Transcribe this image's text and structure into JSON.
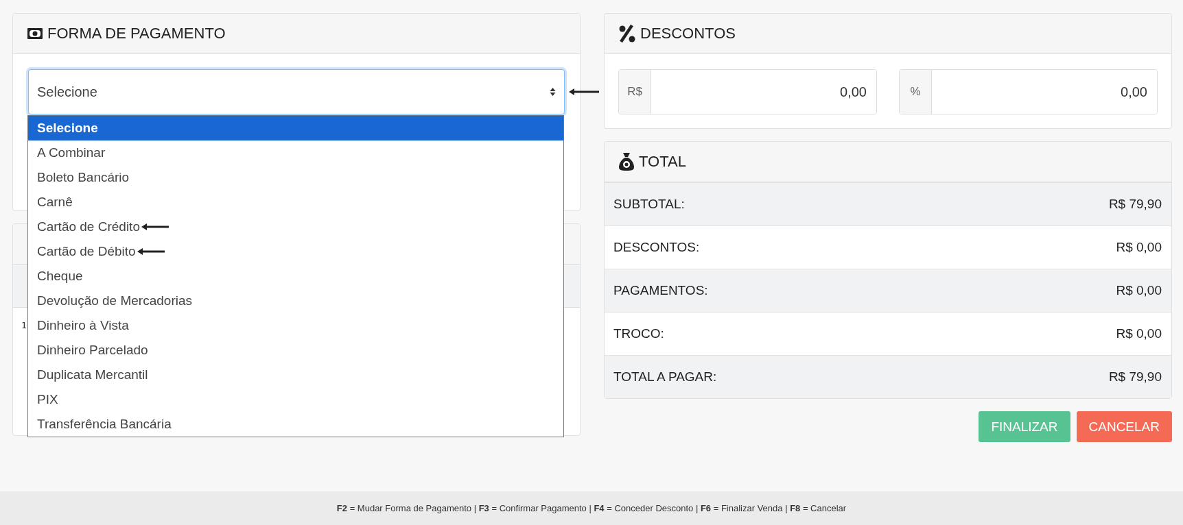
{
  "payment": {
    "title": "FORMA DE PAGAMENTO",
    "select": {
      "value": "Selecione",
      "marked": true
    },
    "options": [
      {
        "label": "Selecione",
        "selected": true,
        "marked": false
      },
      {
        "label": "A Combinar",
        "selected": false,
        "marked": false
      },
      {
        "label": "Boleto Bancário",
        "selected": false,
        "marked": false
      },
      {
        "label": "Carnê",
        "selected": false,
        "marked": false
      },
      {
        "label": "Cartão de Crédito",
        "selected": false,
        "marked": true
      },
      {
        "label": "Cartão de Débito",
        "selected": false,
        "marked": true
      },
      {
        "label": "Cheque",
        "selected": false,
        "marked": false
      },
      {
        "label": "Devolução de Mercadorias",
        "selected": false,
        "marked": false
      },
      {
        "label": "Dinheiro à Vista",
        "selected": false,
        "marked": false
      },
      {
        "label": "Dinheiro Parcelado",
        "selected": false,
        "marked": false
      },
      {
        "label": "Duplicata Mercantil",
        "selected": false,
        "marked": false
      },
      {
        "label": "PIX",
        "selected": false,
        "marked": false
      },
      {
        "label": "Transferência Bancária",
        "selected": false,
        "marked": false
      }
    ]
  },
  "payments_panel": {
    "cell_1": "1"
  },
  "discounts": {
    "title": "DESCONTOS",
    "fields": [
      {
        "prefix": "R$",
        "value": "0,00"
      },
      {
        "prefix": "%",
        "value": "0,00"
      }
    ]
  },
  "total": {
    "title": "TOTAL",
    "rows": [
      {
        "label": "SUBTOTAL:",
        "value": "R$ 79,90"
      },
      {
        "label": "DESCONTOS:",
        "value": "R$ 0,00"
      },
      {
        "label": "PAGAMENTOS:",
        "value": "R$ 0,00"
      },
      {
        "label": "TROCO:",
        "value": "R$ 0,00"
      },
      {
        "label": "TOTAL A PAGAR:",
        "value": "R$ 79,90"
      }
    ]
  },
  "buttons": [
    {
      "label": "FINALIZAR",
      "kind": "confirm"
    },
    {
      "label": "CANCELAR",
      "kind": "cancel"
    }
  ],
  "footer": "**F2** = Mudar Forma de Pagamento | **F3** = Confirmar Pagamento | **F4** = Conceder Desconto | **F6** = Finalizar Venda | **F8** = Cancelar"
}
